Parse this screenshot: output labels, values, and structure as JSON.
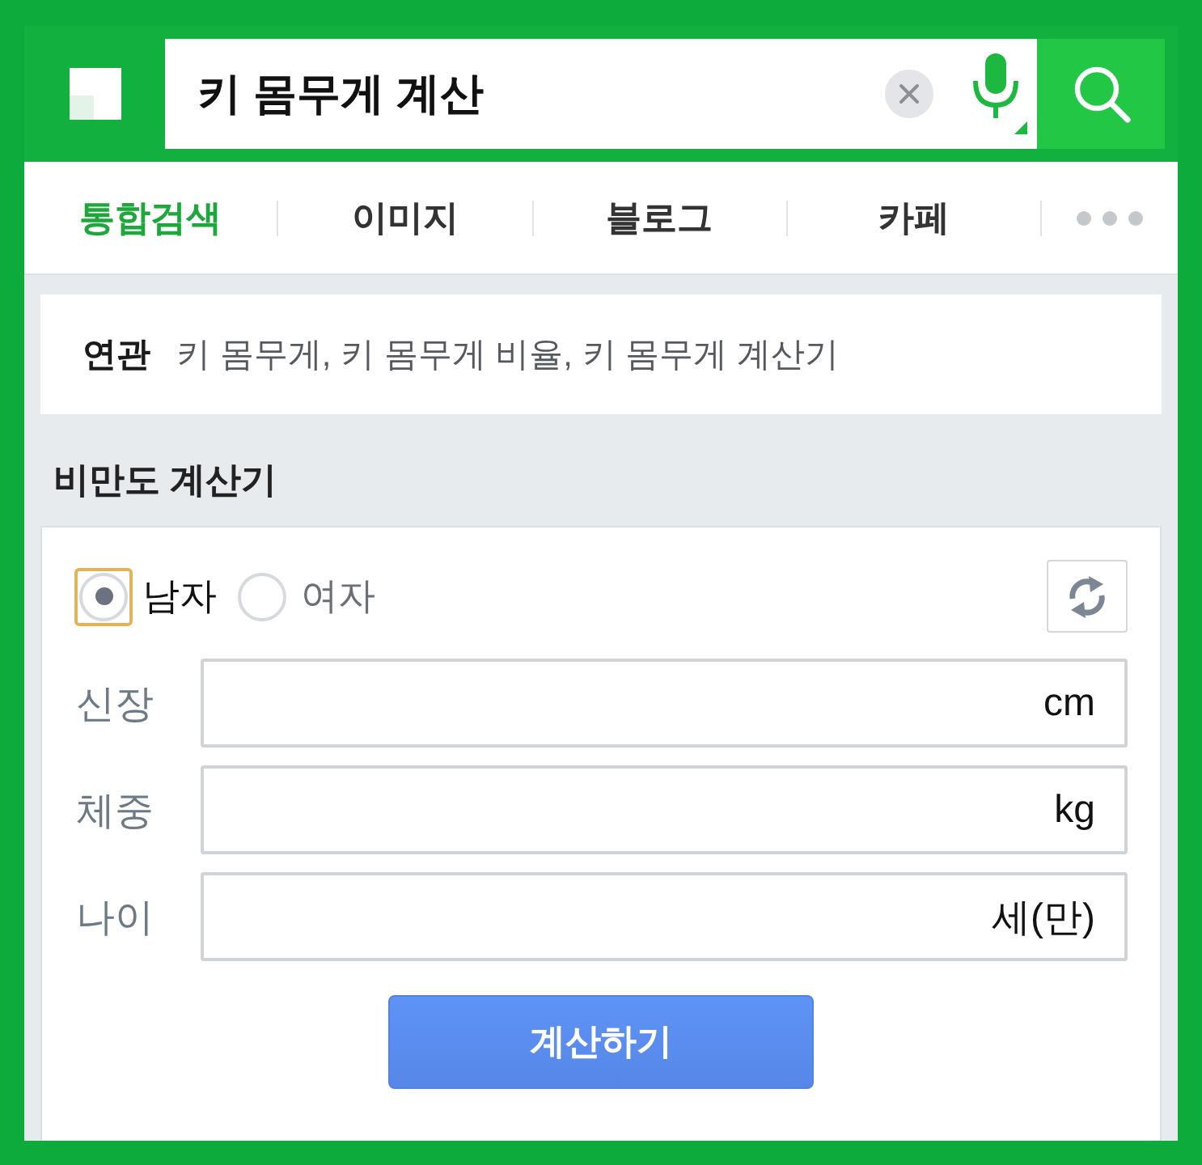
{
  "search": {
    "query": "키 몸무게 계산"
  },
  "tabs": [
    {
      "label": "통합검색",
      "selected": true
    },
    {
      "label": "이미지",
      "selected": false
    },
    {
      "label": "블로그",
      "selected": false
    },
    {
      "label": "카페",
      "selected": false
    }
  ],
  "related": {
    "label": "연관",
    "terms": "키 몸무게, 키 몸무게 비율, 키 몸무게 계산기"
  },
  "calculator": {
    "title": "비만도 계산기",
    "gender": [
      {
        "label": "남자",
        "selected": true,
        "focused": true
      },
      {
        "label": "여자",
        "selected": false,
        "focused": false
      }
    ],
    "fields": [
      {
        "label": "신장",
        "unit": "cm"
      },
      {
        "label": "체중",
        "unit": "kg"
      },
      {
        "label": "나이",
        "unit": "세(만)"
      }
    ],
    "submit": "계산하기"
  }
}
